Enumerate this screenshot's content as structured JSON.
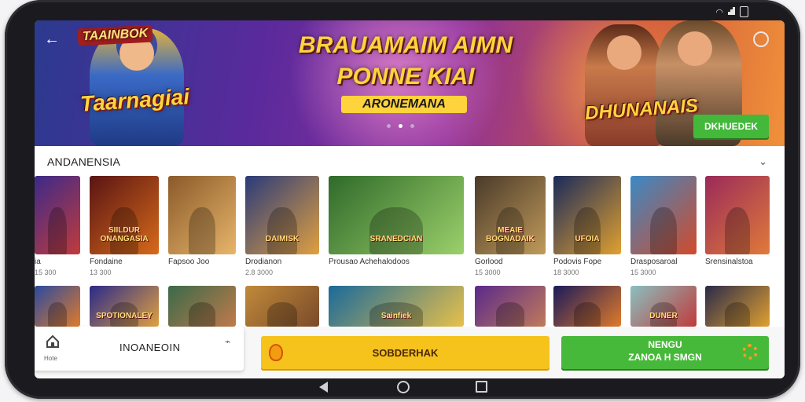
{
  "banner": {
    "title_line1": "BRAUAMAIM AIMN",
    "title_line2": "PONNE KIAI",
    "subtitle": "ARONEMANA",
    "logo_left": "Taarnagiai",
    "logo_topleft": "TAAINBOK",
    "logo_right": "DHUNANAIS",
    "cta_label": "DKHUEDEK"
  },
  "section": {
    "title": "ANDANENSIA"
  },
  "games_row1": [
    {
      "name": "ia",
      "size": "15 300",
      "title": "",
      "c1": "#3b2a8a",
      "c2": "#c23b3b"
    },
    {
      "name": "Fondaine",
      "size": "13 300",
      "title": "SIILDUR ONANGASIA",
      "c1": "#5a1414",
      "c2": "#d66a1a"
    },
    {
      "name": "Fapsoo Joo",
      "size": "",
      "title": "",
      "c1": "#8a5a2a",
      "c2": "#e8b56a"
    },
    {
      "name": "Drodianon",
      "size": "2.8 3000",
      "title": "DAIMISK",
      "c1": "#2a3a7a",
      "c2": "#e0a040"
    },
    {
      "name": "Prousao Achehalodoos",
      "size": "",
      "title": "SRANEDCIAN",
      "c1": "#2f6a2a",
      "c2": "#9bd06a"
    },
    {
      "name": "Gorlood",
      "size": "15 3000",
      "title": "MEAIE BOGNADAIK",
      "c1": "#4a3a2a",
      "c2": "#c09a5a"
    },
    {
      "name": "Podovis Fope",
      "size": "18 3000",
      "title": "UFOIA",
      "c1": "#1a2a5a",
      "c2": "#e0a030"
    },
    {
      "name": "Drasposaroal",
      "size": "15 3000",
      "title": "",
      "c1": "#3a8ac6",
      "c2": "#d24a2a"
    },
    {
      "name": "Srensinalstoa",
      "size": "",
      "title": "",
      "c1": "#9a2a5a",
      "c2": "#e07a3a"
    }
  ],
  "games_row2": [
    {
      "title": "",
      "c1": "#2a4aa0",
      "c2": "#e07a2a"
    },
    {
      "title": "SPOTIONALEY",
      "c1": "#2a2a8a",
      "c2": "#e0a040"
    },
    {
      "title": "",
      "c1": "#3a6a4a",
      "c2": "#c07a4a"
    },
    {
      "title": "",
      "c1": "#c08a3a",
      "c2": "#7a4a2a"
    },
    {
      "title": "Sainfiek",
      "c1": "#1a6a9a",
      "c2": "#e8c04a"
    },
    {
      "title": "",
      "c1": "#5a2a8a",
      "c2": "#c07a5a"
    },
    {
      "title": "",
      "c1": "#1a1a5a",
      "c2": "#e07a2a"
    },
    {
      "title": "DUNER",
      "c1": "#8ac0c0",
      "c2": "#c03a3a"
    },
    {
      "title": "",
      "c1": "#2a2a4a",
      "c2": "#e0a030"
    }
  ],
  "bottom": {
    "home_label": "Hote",
    "home_title": "INOANEOIN",
    "yellow_button": "SOBDERHAK",
    "green_button_line1": "NENGU",
    "green_button_line2": "ZANOA H SMGN"
  }
}
